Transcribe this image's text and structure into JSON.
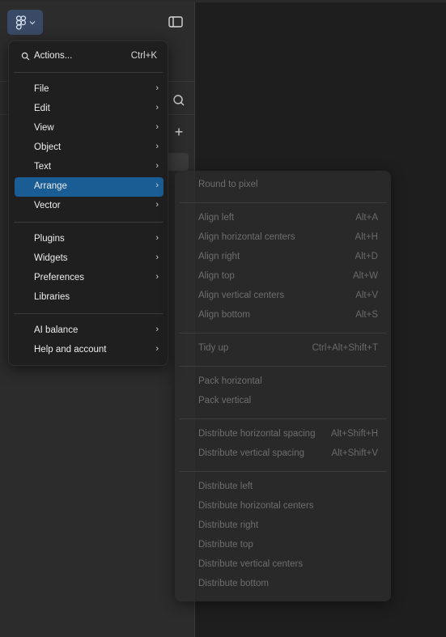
{
  "colors": {
    "accent": "#1a5d94",
    "menu_bg": "#1f1f1f",
    "panel_bg": "#2c2c2c",
    "canvas_bg": "#1e1e1e"
  },
  "header": {
    "logo_icon": "figma-logo-icon",
    "chevron_icon": "chevron-down-icon",
    "panel_toggle_icon": "sidebar-toggle-icon"
  },
  "panel": {
    "search_icon": "search-icon",
    "add_icon": "plus-icon",
    "add_label": "+"
  },
  "menu": {
    "actions": {
      "label": "Actions...",
      "shortcut": "Ctrl+K"
    },
    "group1": [
      {
        "label": "File",
        "arrow": "›"
      },
      {
        "label": "Edit",
        "arrow": "›"
      },
      {
        "label": "View",
        "arrow": "›"
      },
      {
        "label": "Object",
        "arrow": "›"
      },
      {
        "label": "Text",
        "arrow": "›"
      },
      {
        "label": "Arrange",
        "arrow": "›",
        "active": true
      },
      {
        "label": "Vector",
        "arrow": "›"
      }
    ],
    "group2": [
      {
        "label": "Plugins",
        "arrow": "›"
      },
      {
        "label": "Widgets",
        "arrow": "›"
      },
      {
        "label": "Preferences",
        "arrow": "›"
      },
      {
        "label": "Libraries",
        "arrow": ""
      }
    ],
    "group3": [
      {
        "label": "AI balance",
        "arrow": "›"
      },
      {
        "label": "Help and account",
        "arrow": "›"
      }
    ]
  },
  "submenu": {
    "round": {
      "label": "Round to pixel"
    },
    "align": [
      {
        "label": "Align left",
        "shortcut": "Alt+A"
      },
      {
        "label": "Align horizontal centers",
        "shortcut": "Alt+H"
      },
      {
        "label": "Align right",
        "shortcut": "Alt+D"
      },
      {
        "label": "Align top",
        "shortcut": "Alt+W"
      },
      {
        "label": "Align vertical centers",
        "shortcut": "Alt+V"
      },
      {
        "label": "Align bottom",
        "shortcut": "Alt+S"
      }
    ],
    "tidy": {
      "label": "Tidy up",
      "shortcut": "Ctrl+Alt+Shift+T"
    },
    "pack": [
      {
        "label": "Pack horizontal"
      },
      {
        "label": "Pack vertical"
      }
    ],
    "spacing": [
      {
        "label": "Distribute horizontal spacing",
        "shortcut": "Alt+Shift+H"
      },
      {
        "label": "Distribute vertical spacing",
        "shortcut": "Alt+Shift+V"
      }
    ],
    "distribute": [
      {
        "label": "Distribute left"
      },
      {
        "label": "Distribute horizontal centers"
      },
      {
        "label": "Distribute right"
      },
      {
        "label": "Distribute top"
      },
      {
        "label": "Distribute vertical centers"
      },
      {
        "label": "Distribute bottom"
      }
    ]
  }
}
